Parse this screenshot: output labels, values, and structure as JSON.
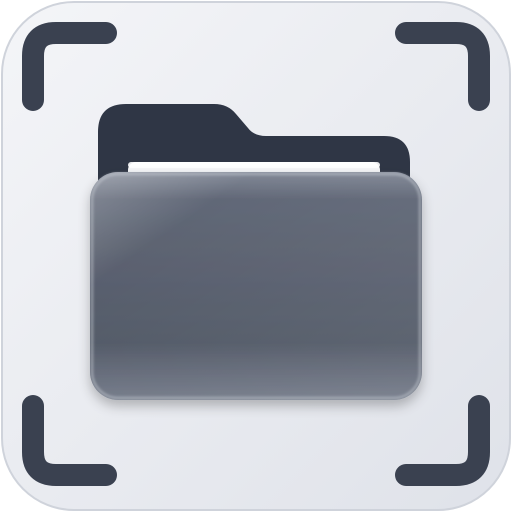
{
  "icon": {
    "name": "folder-scan-app-icon",
    "glyphs": [
      "scan-frame-icon",
      "folder-icon"
    ],
    "colors": {
      "tile_light": "#f4f5f8",
      "tile_dark": "#dfe2e9",
      "tile_edge": "#cfd3db",
      "bracket": "#3a4150",
      "folder_back": "#2f3645",
      "paper": "#f6f7f9",
      "glass_top": "#7c8392",
      "glass_bottom": "#4a5160"
    }
  }
}
